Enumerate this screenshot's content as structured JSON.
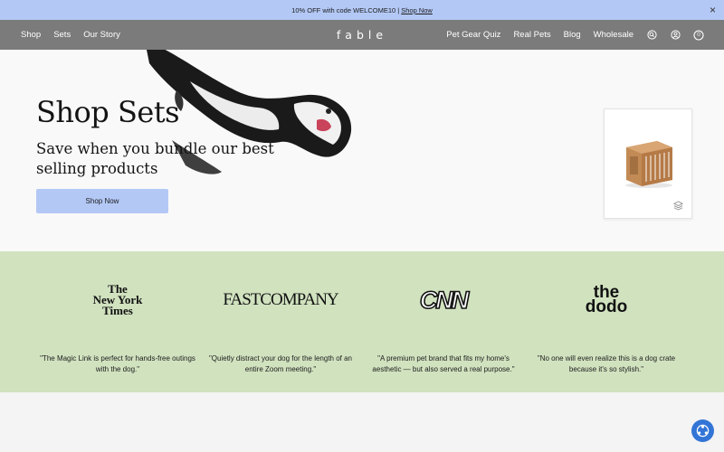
{
  "announcement": {
    "text": "10% OFF with code WELCOME10 |",
    "link": "Shop Now",
    "close": "×"
  },
  "nav": {
    "left": [
      "Shop",
      "Sets",
      "Our Story"
    ],
    "logo": "fable",
    "right": [
      "Pet Gear Quiz",
      "Real Pets",
      "Blog",
      "Wholesale"
    ],
    "icons": [
      "search-icon",
      "account-icon",
      "cart-icon"
    ],
    "cart_count": "0"
  },
  "hero": {
    "title": "Shop Sets",
    "subtitle": "Save when you bundle our best selling products",
    "button": "Shop Now"
  },
  "press": [
    {
      "outlet": "The New York Times",
      "logo_lines": [
        "The",
        "New York",
        "Times"
      ],
      "quote": "\"The Magic Link is perfect for hands-free outings with the dog.\""
    },
    {
      "outlet": "FAST COMPANY",
      "logo_lines": [
        "FASTCOMPANY"
      ],
      "quote": "\"Quietly distract your dog for the length of an entire Zoom meeting.\""
    },
    {
      "outlet": "CNN",
      "logo_lines": [
        "CNN"
      ],
      "quote": "\"A premium pet brand that fits my home's aesthetic — but also served a real purpose.\""
    },
    {
      "outlet": "the dodo",
      "logo_lines": [
        "the",
        "dodo"
      ],
      "quote": "\"No one will even realize this is a dog crate because it's so stylish.\""
    }
  ],
  "colors": {
    "announcement_bg": "#b3c8f5",
    "nav_bg": "#7b7b7b",
    "press_bg": "#d1e2bf",
    "button_bg": "#b3c8f5",
    "chat_bg": "#3375d6"
  }
}
